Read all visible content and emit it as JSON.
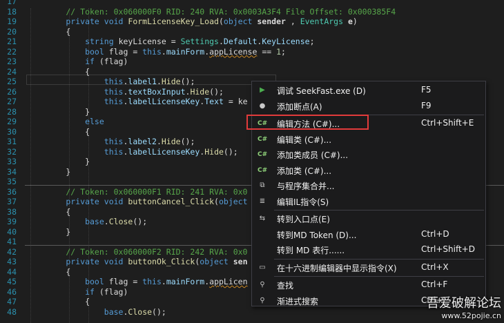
{
  "editor": {
    "lines": [
      {
        "n": "17",
        "tokens": [
          [
            "",
            ""
          ]
        ]
      },
      {
        "n": "18",
        "tokens": [
          [
            "c",
            "        // Token: 0x060000F0 RID: 240 RVA: 0x0003A3F4 File Offset: 0x000385F4"
          ]
        ]
      },
      {
        "n": "19",
        "tokens": [
          [
            "k",
            "        private void "
          ],
          [
            "m",
            "FormLicenseKey_Load"
          ],
          [
            "",
            "("
          ],
          [
            "k",
            "object "
          ],
          [
            "b",
            "sender"
          ],
          [
            "",
            " , "
          ],
          [
            "t",
            "EventArgs "
          ],
          [
            "b",
            "e"
          ],
          [
            "",
            ")"
          ]
        ]
      },
      {
        "n": "20",
        "tokens": [
          [
            "",
            "        {"
          ]
        ]
      },
      {
        "n": "21",
        "tokens": [
          [
            "k",
            "            string "
          ],
          [
            "",
            "keyLicense = "
          ],
          [
            "t",
            "Settings"
          ],
          [
            "",
            "."
          ],
          [
            "p",
            "Default"
          ],
          [
            "",
            "."
          ],
          [
            "p",
            "KeyLicense"
          ],
          [
            "",
            ";"
          ]
        ]
      },
      {
        "n": "22",
        "tokens": [
          [
            "k",
            "            bool "
          ],
          [
            "",
            "flag = "
          ],
          [
            "k",
            "this"
          ],
          [
            "",
            "."
          ],
          [
            "p",
            "mainForm"
          ],
          [
            "",
            "."
          ],
          [
            "u",
            "appLicense"
          ],
          [
            "",
            " == "
          ],
          [
            "n",
            "1"
          ],
          [
            "",
            ";"
          ]
        ]
      },
      {
        "n": "23",
        "tokens": [
          [
            "k",
            "            if "
          ],
          [
            "",
            "(flag)"
          ]
        ]
      },
      {
        "n": "24",
        "tokens": [
          [
            "",
            "            {"
          ]
        ]
      },
      {
        "n": "25",
        "tokens": [
          [
            "k",
            "                this"
          ],
          [
            "",
            "."
          ],
          [
            "p",
            "label1"
          ],
          [
            "",
            "."
          ],
          [
            "m",
            "Hide"
          ],
          [
            "",
            "();"
          ]
        ]
      },
      {
        "n": "26",
        "tokens": [
          [
            "k",
            "                this"
          ],
          [
            "",
            "."
          ],
          [
            "p",
            "textBoxInput"
          ],
          [
            "",
            "."
          ],
          [
            "m",
            "Hide"
          ],
          [
            "",
            "();"
          ]
        ]
      },
      {
        "n": "27",
        "tokens": [
          [
            "k",
            "                this"
          ],
          [
            "",
            "."
          ],
          [
            "p",
            "labelLicenseKey"
          ],
          [
            "",
            "."
          ],
          [
            "p",
            "Text"
          ],
          [
            "",
            " = ke"
          ]
        ]
      },
      {
        "n": "28",
        "tokens": [
          [
            "",
            "            }"
          ]
        ]
      },
      {
        "n": "29",
        "tokens": [
          [
            "k",
            "            else"
          ]
        ]
      },
      {
        "n": "30",
        "tokens": [
          [
            "",
            "            {"
          ]
        ]
      },
      {
        "n": "31",
        "tokens": [
          [
            "k",
            "                this"
          ],
          [
            "",
            "."
          ],
          [
            "p",
            "label2"
          ],
          [
            "",
            "."
          ],
          [
            "m",
            "Hide"
          ],
          [
            "",
            "();"
          ]
        ]
      },
      {
        "n": "32",
        "tokens": [
          [
            "k",
            "                this"
          ],
          [
            "",
            "."
          ],
          [
            "p",
            "labelLicenseKey"
          ],
          [
            "",
            "."
          ],
          [
            "m",
            "Hide"
          ],
          [
            "",
            "();"
          ]
        ]
      },
      {
        "n": "33",
        "tokens": [
          [
            "",
            "            }"
          ]
        ]
      },
      {
        "n": "34",
        "tokens": [
          [
            "",
            "        }"
          ]
        ]
      },
      {
        "n": "35",
        "tokens": [
          [
            "",
            ""
          ]
        ]
      },
      {
        "n": "36",
        "tokens": [
          [
            "c",
            "        // Token: 0x060000F1 RID: 241 RVA: 0x0"
          ]
        ]
      },
      {
        "n": "37",
        "tokens": [
          [
            "k",
            "        private void "
          ],
          [
            "m",
            "buttonCancel_Click"
          ],
          [
            "",
            "("
          ],
          [
            "k",
            "object"
          ]
        ]
      },
      {
        "n": "38",
        "tokens": [
          [
            "",
            "        {"
          ]
        ]
      },
      {
        "n": "39",
        "tokens": [
          [
            "k",
            "            base"
          ],
          [
            "",
            "."
          ],
          [
            "m",
            "Close"
          ],
          [
            "",
            "();"
          ]
        ]
      },
      {
        "n": "40",
        "tokens": [
          [
            "",
            "        }"
          ]
        ]
      },
      {
        "n": "41",
        "tokens": [
          [
            "",
            ""
          ]
        ]
      },
      {
        "n": "42",
        "tokens": [
          [
            "c",
            "        // Token: 0x060000F2 RID: 242 RVA: 0x0"
          ]
        ]
      },
      {
        "n": "43",
        "tokens": [
          [
            "k",
            "        private void "
          ],
          [
            "m",
            "buttonOk_Click"
          ],
          [
            "",
            "("
          ],
          [
            "k",
            "object "
          ],
          [
            "b",
            "sen"
          ]
        ]
      },
      {
        "n": "44",
        "tokens": [
          [
            "",
            "        {"
          ]
        ]
      },
      {
        "n": "45",
        "tokens": [
          [
            "k",
            "            bool "
          ],
          [
            "",
            "flag = "
          ],
          [
            "k",
            "this"
          ],
          [
            "",
            "."
          ],
          [
            "p",
            "mainForm"
          ],
          [
            "",
            "."
          ],
          [
            "u",
            "appLicen"
          ]
        ]
      },
      {
        "n": "46",
        "tokens": [
          [
            "k",
            "            if "
          ],
          [
            "",
            "(flag)"
          ]
        ]
      },
      {
        "n": "47",
        "tokens": [
          [
            "",
            "            {"
          ]
        ]
      },
      {
        "n": "48",
        "tokens": [
          [
            "k",
            "                base"
          ],
          [
            "",
            "."
          ],
          [
            "m",
            "Close"
          ],
          [
            "",
            "();"
          ]
        ]
      }
    ]
  },
  "context_menu": {
    "items": [
      {
        "icon": "play-icon",
        "glyph": "▶",
        "label": "调试 SeekFast.exe (D)",
        "shortcut": "F5"
      },
      {
        "icon": "breakpoint-icon",
        "glyph": "●",
        "label": "添加断点(A)",
        "shortcut": "F9"
      },
      {
        "sep": true
      },
      {
        "icon": "csharp-icon",
        "glyph": "C#",
        "label": "编辑方法 (C#)...",
        "shortcut": "Ctrl+Shift+E"
      },
      {
        "icon": "csharp-icon",
        "glyph": "C#",
        "label": "编辑类 (C#)...",
        "shortcut": ""
      },
      {
        "icon": "csharp-icon",
        "glyph": "C#",
        "label": "添加类成员 (C#)...",
        "shortcut": ""
      },
      {
        "icon": "csharp-icon",
        "glyph": "C#",
        "label": "添加类 (C#)...",
        "shortcut": ""
      },
      {
        "icon": "merge-assembly-icon",
        "glyph": "⧉",
        "label": "与程序集合并...",
        "shortcut": ""
      },
      {
        "icon": "il-instructions-icon",
        "glyph": "≣",
        "label": "编辑IL指令(S)",
        "shortcut": ""
      },
      {
        "sep": true
      },
      {
        "icon": "entry-point-icon",
        "glyph": "⇆",
        "label": "转到入口点(E)",
        "shortcut": ""
      },
      {
        "icon": "",
        "glyph": "",
        "label": "转到MD Token (D)...",
        "shortcut": "Ctrl+D"
      },
      {
        "icon": "",
        "glyph": "",
        "label": "转到 MD 表行......",
        "shortcut": "Ctrl+Shift+D"
      },
      {
        "sep": true
      },
      {
        "icon": "hex-editor-icon",
        "glyph": "▭",
        "label": "在十六进制编辑器中显示指令(X)",
        "shortcut": "Ctrl+X"
      },
      {
        "sep": true
      },
      {
        "icon": "search-icon",
        "glyph": "⚲",
        "label": "查找",
        "shortcut": "Ctrl+F"
      },
      {
        "icon": "incremental-search-icon",
        "glyph": "⚲",
        "label": "渐进式搜索",
        "shortcut": "Ctrl+I"
      }
    ]
  },
  "watermark": {
    "title": "吾爱破解论坛",
    "url": "www.52pojie.cn"
  },
  "colors": {
    "highlight_box": "#e23b3b",
    "menu_bg": "#1b1b1c",
    "editor_bg": "#1e1e1e"
  }
}
